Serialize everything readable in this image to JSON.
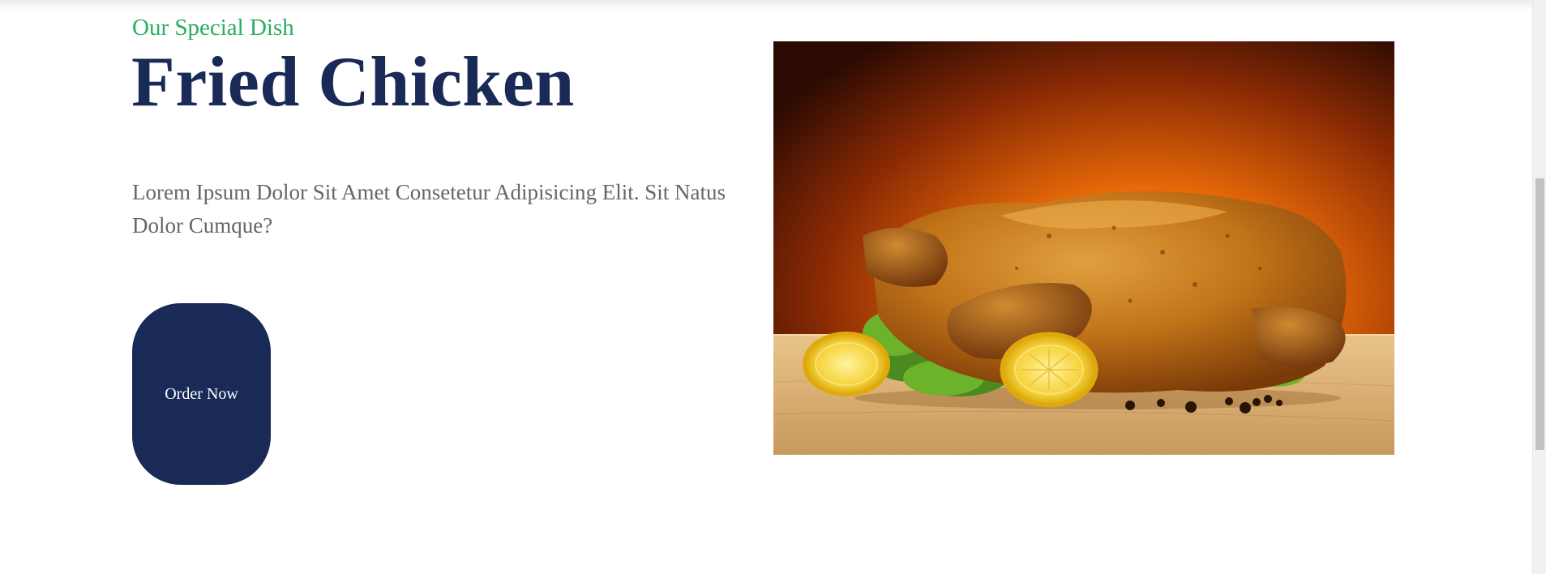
{
  "special": {
    "subtitle": "Our Special Dish",
    "title": "Fried Chicken",
    "description": "Lorem Ipsum Dolor Sit Amet Consetetur Adipisicing Elit. Sit Natus Dolor Cumque?",
    "button_label": "Order Now",
    "image_icon": "roast-chicken-photo"
  },
  "colors": {
    "accent_green": "#27ae60",
    "brand_navy": "#192a56",
    "text_gray": "#666666"
  }
}
